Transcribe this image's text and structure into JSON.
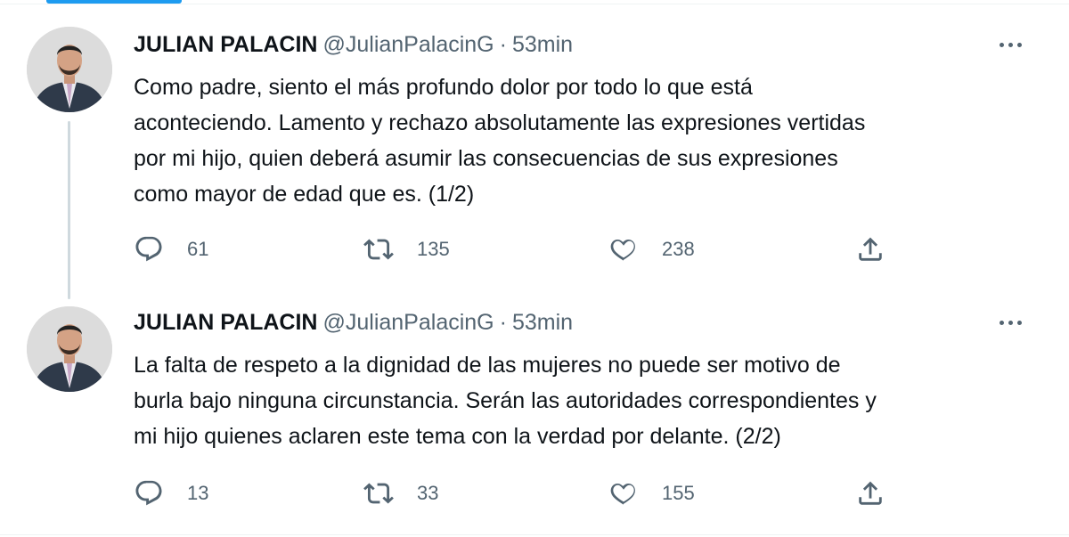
{
  "tweets": [
    {
      "name": "JULIAN PALACIN",
      "handle": "@JulianPalacinG",
      "separator": "·",
      "time": "53min",
      "lines": [
        "Como padre, siento el más profundo dolor por todo lo que está",
        "aconteciendo. Lamento y rechazo absolutamente las expresiones vertidas",
        "por mi hijo, quien deberá asumir las consecuencias de sus expresiones",
        "como mayor de edad que es. (1/2)"
      ],
      "replies": "61",
      "retweets": "135",
      "likes": "238"
    },
    {
      "name": "JULIAN PALACIN",
      "handle": "@JulianPalacinG",
      "separator": "·",
      "time": "53min",
      "lines": [
        "La falta de respeto a la dignidad de las mujeres no puede ser motivo de",
        "burla bajo ninguna circunstancia. Serán las autoridades correspondientes y",
        "mi hijo quienes aclaren este tema con la verdad por delante. (2/2)"
      ],
      "replies": "13",
      "retweets": "33",
      "likes": "155"
    }
  ],
  "icons": {
    "more": "more-icon",
    "reply": "reply-icon",
    "retweet": "retweet-icon",
    "like": "like-icon",
    "share": "share-icon"
  },
  "colors": {
    "text": "#0f1419",
    "secondary": "#536471",
    "accent": "#1d9bf0",
    "thread_line": "#cfd9de"
  }
}
